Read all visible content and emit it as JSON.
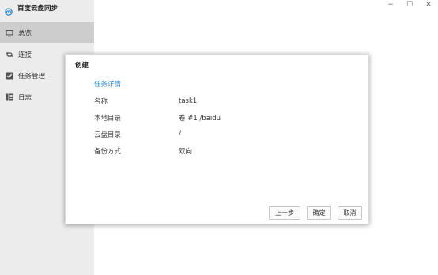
{
  "app": {
    "title": "百度云盘同步"
  },
  "sidebar": {
    "items": [
      {
        "label": "总览",
        "icon": "monitor-icon",
        "active": true
      },
      {
        "label": "连接",
        "icon": "link-icon",
        "active": false
      },
      {
        "label": "任务管理",
        "icon": "checkbox-icon",
        "active": false
      },
      {
        "label": "日志",
        "icon": "book-icon",
        "active": false
      }
    ]
  },
  "window": {
    "minimize": "−",
    "maximize": "☐",
    "close": "✕"
  },
  "dialog": {
    "title": "创建",
    "section": "任务详情",
    "rows": [
      {
        "label": "名称",
        "value": "task1"
      },
      {
        "label": "本地目录",
        "value": "卷 #1 /baidu"
      },
      {
        "label": "云盘目录",
        "value": "/"
      },
      {
        "label": "备份方式",
        "value": "双向"
      }
    ],
    "buttons": {
      "prev": "上一步",
      "confirm": "确定",
      "cancel": "取消"
    }
  },
  "colors": {
    "accent": "#2a8ad4",
    "sidebar_bg": "#ececec",
    "sidebar_active": "#cdcdcd"
  }
}
